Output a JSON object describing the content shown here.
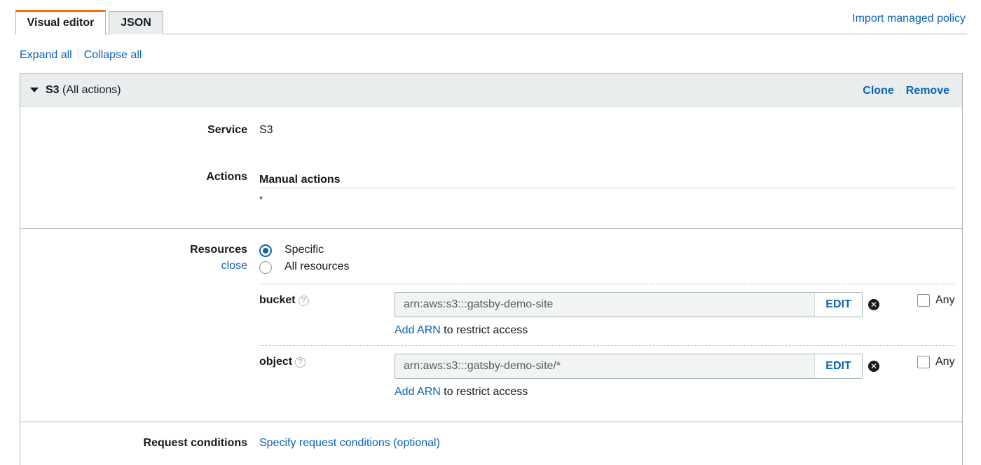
{
  "tabs": [
    {
      "label": "Visual editor",
      "active": true
    },
    {
      "label": "JSON",
      "active": false
    }
  ],
  "import_policy_label": "Import managed policy",
  "expand_all_label": "Expand all",
  "collapse_all_label": "Collapse all",
  "statement": {
    "service_short": "S3",
    "actions_summary": "(All actions)",
    "clone_label": "Clone",
    "remove_label": "Remove",
    "service_label": "Service",
    "service_value": "S3",
    "actions_label": "Actions",
    "manual_actions_heading": "Manual actions",
    "actions_value": "*",
    "resources_label": "Resources",
    "close_label": "close",
    "radio_options": [
      {
        "label": "Specific",
        "checked": true
      },
      {
        "label": "All resources",
        "checked": false
      }
    ],
    "resources": [
      {
        "name": "bucket",
        "arn": "arn:aws:s3:::gatsby-demo-site",
        "edit_label": "EDIT",
        "any_label": "Any",
        "add_arn_label": "Add ARN",
        "restrict_text": "to restrict access"
      },
      {
        "name": "object",
        "arn": "arn:aws:s3:::gatsby-demo-site/*",
        "edit_label": "EDIT",
        "any_label": "Any",
        "add_arn_label": "Add ARN",
        "restrict_text": "to restrict access"
      }
    ],
    "request_conditions_label": "Request conditions",
    "request_conditions_link": "Specify request conditions (optional)"
  },
  "colors": {
    "link": "#0b63b5",
    "active_tab_accent": "#ec7211",
    "header_bg": "#eaeded"
  },
  "icons": [
    "caret-down-icon",
    "help-icon",
    "remove-circle-icon"
  ]
}
